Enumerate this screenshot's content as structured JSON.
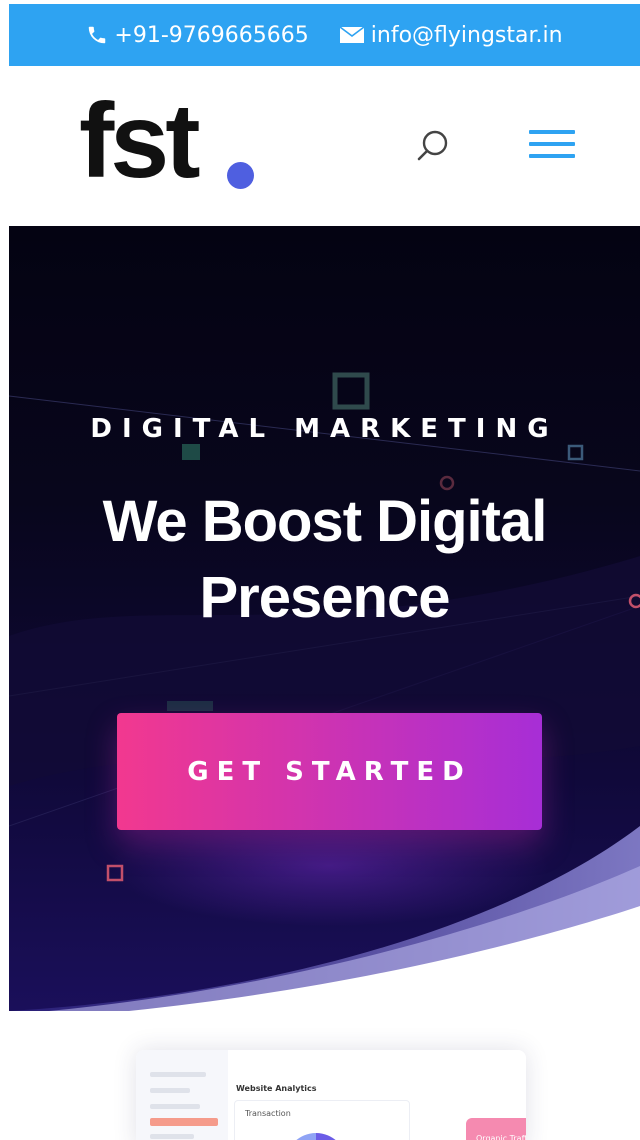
{
  "topbar": {
    "phone": "+91-9769665665",
    "email": "info@flyingstar.in",
    "phone_icon": "phone-icon",
    "email_icon": "envelope-icon",
    "color": "#2ea3f2"
  },
  "header": {
    "logo_text": "fst",
    "logo_dot_color": "#4f5fe0",
    "search_icon": "search-icon",
    "menu_icon": "hamburger-menu-icon"
  },
  "hero": {
    "eyebrow": "DIGITAL MARKETING",
    "headline_line1": "We Boost Digital",
    "headline_line2": "Presence",
    "cta_label": "GET STARTED",
    "cta_gradient": [
      "#f2388f",
      "#a72ed6"
    ]
  },
  "preview": {
    "title": "Website Analytics",
    "card_subtitle": "Transaction",
    "chip_label": "Organic Traffic"
  }
}
